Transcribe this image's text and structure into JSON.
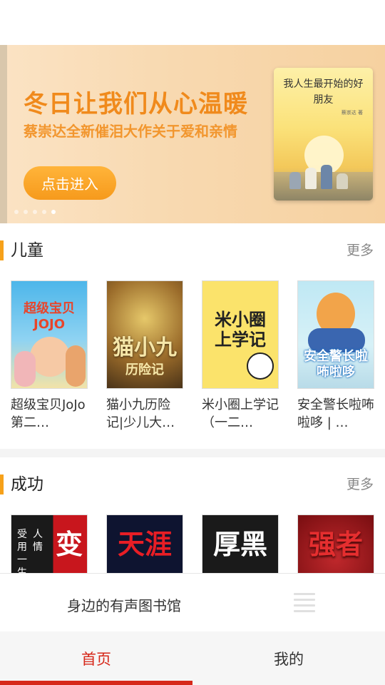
{
  "banner": {
    "title": "冬日让我们从心温暖",
    "subtitle": "蔡崇达全新催泪大作关于爱和亲情",
    "button_label": "点击进入",
    "book_title": "我人生最开始的好朋友",
    "book_author": "蔡崇达 著",
    "slide_count": 5,
    "active_slide": 5
  },
  "sections": [
    {
      "title": "儿童",
      "more_label": "更多",
      "books": [
        {
          "caption": "超级宝贝JoJo第二…",
          "cover_text": "超级宝贝JOJO"
        },
        {
          "caption": "猫小九历险记|少儿大…",
          "cover_text": "猫小九",
          "cover_text2": "历险记"
        },
        {
          "caption": "米小圈上学记（一二…",
          "cover_text": "米小圈上学记"
        },
        {
          "caption": "安全警长啦咘啦哆 | …",
          "cover_text": "安全警长啦咘啦哆"
        }
      ]
    },
    {
      "title": "成功",
      "more_label": "更多",
      "books": [
        {
          "cover_text": "变",
          "side_text": "受用一生",
          "side_text2": "人情"
        },
        {
          "cover_text": "天涯"
        },
        {
          "cover_text": "厚黑"
        },
        {
          "cover_text": "强者"
        }
      ]
    }
  ],
  "player": {
    "title": "身边的有声图书馆",
    "icon": "playlist-icon"
  },
  "tabs": [
    {
      "label": "首页",
      "active": true
    },
    {
      "label": "我的",
      "active": false
    }
  ],
  "colors": {
    "accent": "#d6281a",
    "section_bar": "#f6a11a",
    "banner_text": "#f08a1c"
  }
}
